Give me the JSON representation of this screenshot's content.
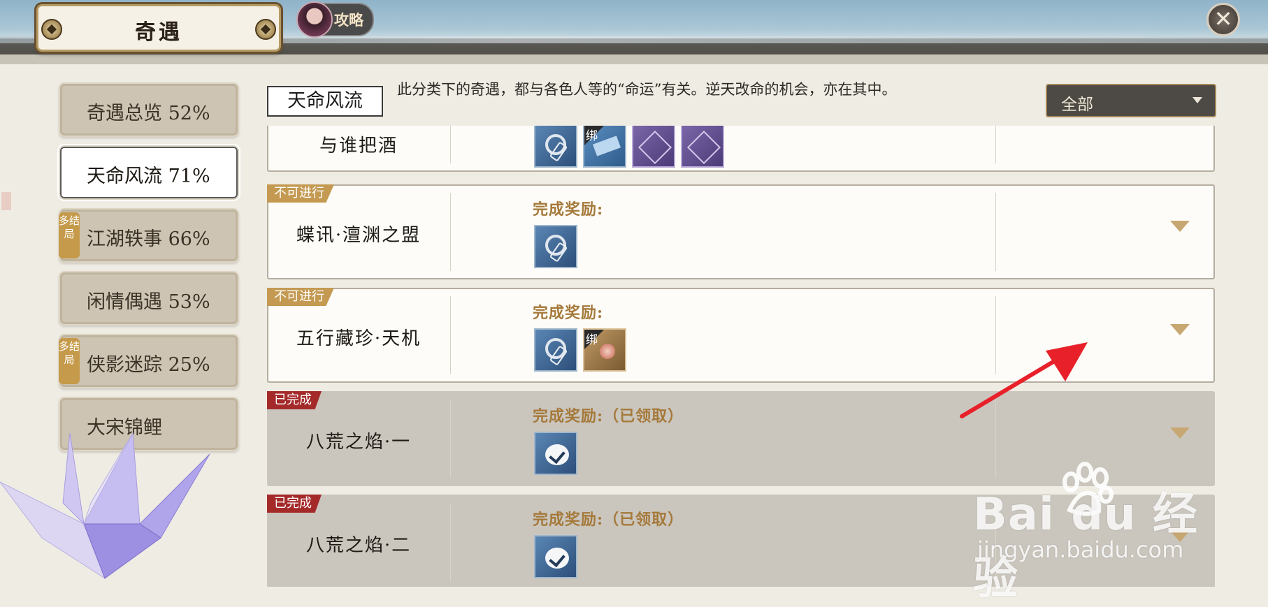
{
  "header": {
    "title": "奇遇",
    "guide_label": "攻略",
    "close_glyph": "✕"
  },
  "sidebar": {
    "items": [
      {
        "label": "奇遇总览  52%"
      },
      {
        "label": "天命风流  71%"
      },
      {
        "label": "江湖轶事  66%",
        "tag": "多结局"
      },
      {
        "label": "闲情偶遇  53%"
      },
      {
        "label": "侠影迷踪  25%",
        "tag": "多结局"
      },
      {
        "label": "大宋锦鲤"
      }
    ]
  },
  "category": {
    "name": "天命风流",
    "description": "此分类下的奇遇，都与各色人等的“命运”有关。逆天改命的机会，亦在其中。",
    "filter": "全部"
  },
  "cards": [
    {
      "name": "与谁把酒",
      "status": "",
      "reward_label": "",
      "rewards": [
        "coin-icon",
        "scroll-icon",
        "favor-icon",
        "favor-icon"
      ]
    },
    {
      "name": "蝶讯·澶渊之盟",
      "status": "不可进行",
      "reward_label": "完成奖励:",
      "rewards": [
        "coin-icon"
      ]
    },
    {
      "name": "五行藏珍·天机",
      "status": "不可进行",
      "reward_label": "完成奖励:",
      "rewards": [
        "coin-icon",
        "flower-icon"
      ]
    },
    {
      "name": "八荒之焰·一",
      "status": "已完成",
      "reward_label": "完成奖励:（已领取）",
      "rewards": [
        "check-icon"
      ]
    },
    {
      "name": "八荒之焰·二",
      "status": "已完成",
      "reward_label": "完成奖励:（已领取）",
      "rewards": [
        "check-icon"
      ]
    }
  ],
  "bound_label": "绑",
  "watermark": {
    "brand": "Bai du 经验",
    "url": "jingyan.baidu.com"
  },
  "colors": {
    "reward_label": "#a5793a",
    "tag_blocked": "#c49a52",
    "tag_done": "#a42a2a"
  }
}
